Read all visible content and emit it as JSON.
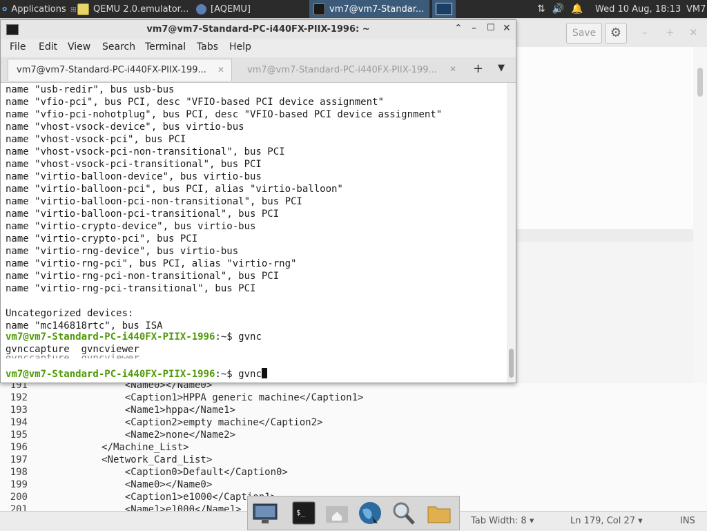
{
  "top_panel": {
    "applications_label": "Applications",
    "tasks": [
      {
        "label": "QEMU 2.0.emulator...",
        "icon": "text-editor-icon"
      },
      {
        "label": "[AQEMU]",
        "icon": "aqemu-icon"
      },
      {
        "label": "vm7@vm7-Standar...",
        "icon": "terminal-icon"
      }
    ],
    "datetime": "Wed 10 Aug, 18:13",
    "user": "VM7"
  },
  "editor": {
    "save_label": "Save",
    "code_lines": [
      {
        "num": "191",
        "text": "                <Name0></Name0>"
      },
      {
        "num": "192",
        "text": "                <Caption1>HPPA generic machine</Caption1>"
      },
      {
        "num": "193",
        "text": "                <Name1>hppa</Name1>"
      },
      {
        "num": "194",
        "text": "                <Caption2>empty machine</Caption2>"
      },
      {
        "num": "195",
        "text": "                <Name2>none</Name2>"
      },
      {
        "num": "196",
        "text": "            </Machine_List>"
      },
      {
        "num": "197",
        "text": "            <Network_Card_List>"
      },
      {
        "num": "198",
        "text": "                <Caption0>Default</Caption0>"
      },
      {
        "num": "199",
        "text": "                <Name0></Name0>"
      },
      {
        "num": "200",
        "text": "                <Caption1>e1000</Caption1>"
      },
      {
        "num": "201",
        "text": "                <Name1>e1000</Name1>"
      }
    ],
    "status": {
      "tab_width": "Tab Width: 8",
      "position": "Ln 179, Col 27",
      "mode": "INS"
    }
  },
  "terminal": {
    "title": "vm7@vm7-Standard-PC-i440FX-PIIX-1996: ~",
    "menu": [
      "File",
      "Edit",
      "View",
      "Search",
      "Terminal",
      "Tabs",
      "Help"
    ],
    "tabs": [
      {
        "label": "vm7@vm7-Standard-PC-i440FX-PIIX-199...",
        "active": true
      },
      {
        "label": "vm7@vm7-Standard-PC-i440FX-PIIX-199...",
        "active": false
      }
    ],
    "lines": [
      "name \"usb-redir\", bus usb-bus",
      "name \"vfio-pci\", bus PCI, desc \"VFIO-based PCI device assignment\"",
      "name \"vfio-pci-nohotplug\", bus PCI, desc \"VFIO-based PCI device assignment\"",
      "name \"vhost-vsock-device\", bus virtio-bus",
      "name \"vhost-vsock-pci\", bus PCI",
      "name \"vhost-vsock-pci-non-transitional\", bus PCI",
      "name \"vhost-vsock-pci-transitional\", bus PCI",
      "name \"virtio-balloon-device\", bus virtio-bus",
      "name \"virtio-balloon-pci\", bus PCI, alias \"virtio-balloon\"",
      "name \"virtio-balloon-pci-non-transitional\", bus PCI",
      "name \"virtio-balloon-pci-transitional\", bus PCI",
      "name \"virtio-crypto-device\", bus virtio-bus",
      "name \"virtio-crypto-pci\", bus PCI",
      "name \"virtio-rng-device\", bus virtio-bus",
      "name \"virtio-rng-pci\", bus PCI, alias \"virtio-rng\"",
      "name \"virtio-rng-pci-non-transitional\", bus PCI",
      "name \"virtio-rng-pci-transitional\", bus PCI",
      "",
      "Uncategorized devices:",
      "name \"mc146818rtc\", bus ISA"
    ],
    "prompt": "vm7@vm7-Standard-PC-i440FX-PIIX-1996",
    "prompt_suffix": ":~$ ",
    "command1": "gvnc",
    "completions": "gvnccapture  gvncviewer",
    "command2": "gvnc"
  },
  "dock": {
    "items": [
      "monitor-icon",
      "terminal-icon",
      "home-folder-icon",
      "browser-globe-icon",
      "search-icon",
      "files-folder-icon"
    ]
  },
  "colors": {
    "panel_bg": "#2b2b2b",
    "prompt_green": "#4e9a06",
    "active_task": "#3c5a7a"
  }
}
